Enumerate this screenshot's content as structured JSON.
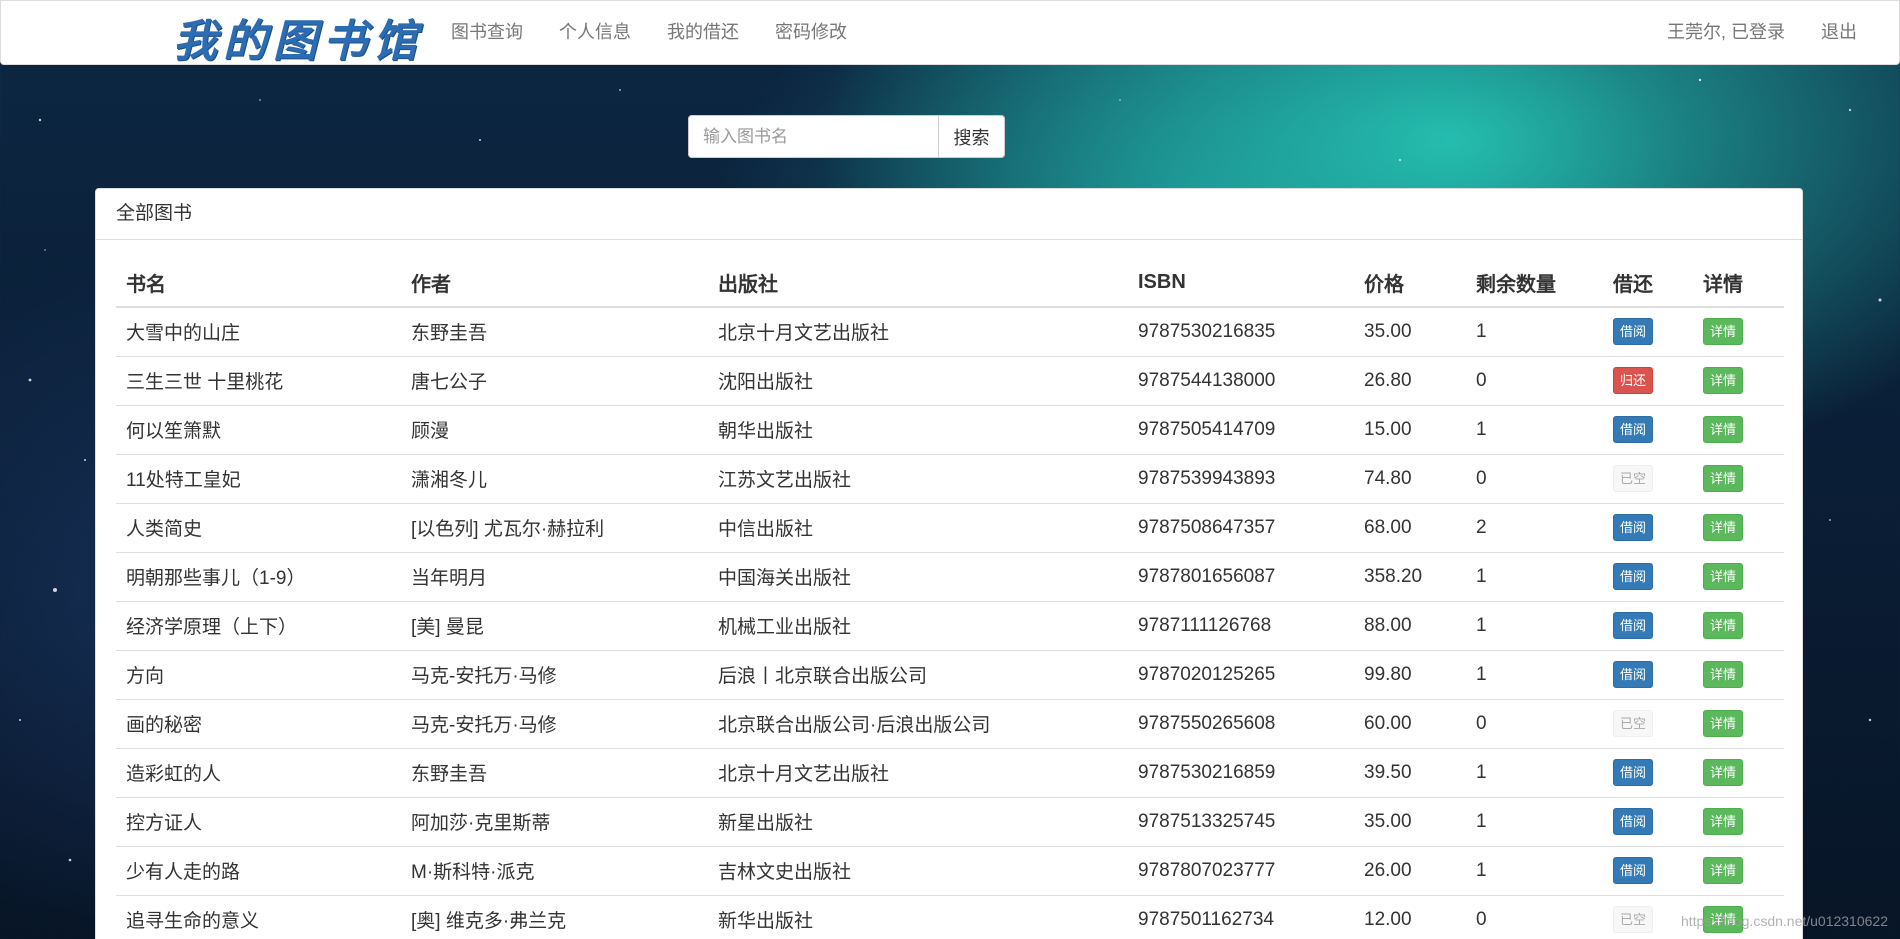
{
  "navbar": {
    "brand": "我的图书馆",
    "links": [
      "图书查询",
      "个人信息",
      "我的借还",
      "密码修改"
    ],
    "user_status": "王莞尔, 已登录",
    "logout": "退出"
  },
  "search": {
    "placeholder": "输入图书名",
    "button": "搜索"
  },
  "panel": {
    "title": "全部图书"
  },
  "table": {
    "headers": [
      "书名",
      "作者",
      "出版社",
      "ISBN",
      "价格",
      "剩余数量",
      "借还",
      "详情"
    ],
    "rows": [
      {
        "title": "大雪中的山庄",
        "author": "东野圭吾",
        "publisher": "北京十月文艺出版社",
        "isbn": "9787530216835",
        "price": "35.00",
        "stock": "1",
        "action": "借阅",
        "action_type": "borrow",
        "detail": "详情"
      },
      {
        "title": "三生三世 十里桃花",
        "author": "唐七公子",
        "publisher": "沈阳出版社",
        "isbn": "9787544138000",
        "price": "26.80",
        "stock": "0",
        "action": "归还",
        "action_type": "return",
        "detail": "详情"
      },
      {
        "title": "何以笙箫默",
        "author": "顾漫",
        "publisher": "朝华出版社",
        "isbn": "9787505414709",
        "price": "15.00",
        "stock": "1",
        "action": "借阅",
        "action_type": "borrow",
        "detail": "详情"
      },
      {
        "title": "11处特工皇妃",
        "author": "潇湘冬儿",
        "publisher": "江苏文艺出版社",
        "isbn": "9787539943893",
        "price": "74.80",
        "stock": "0",
        "action": "已空",
        "action_type": "empty",
        "detail": "详情"
      },
      {
        "title": "人类简史",
        "author": "[以色列] 尤瓦尔·赫拉利",
        "publisher": "中信出版社",
        "isbn": "9787508647357",
        "price": "68.00",
        "stock": "2",
        "action": "借阅",
        "action_type": "borrow",
        "detail": "详情"
      },
      {
        "title": "明朝那些事儿（1-9）",
        "author": "当年明月",
        "publisher": "中国海关出版社",
        "isbn": "9787801656087",
        "price": "358.20",
        "stock": "1",
        "action": "借阅",
        "action_type": "borrow",
        "detail": "详情"
      },
      {
        "title": "经济学原理（上下）",
        "author": "[美] 曼昆",
        "publisher": "机械工业出版社",
        "isbn": "9787111126768",
        "price": "88.00",
        "stock": "1",
        "action": "借阅",
        "action_type": "borrow",
        "detail": "详情"
      },
      {
        "title": "方向",
        "author": "马克-安托万·马修",
        "publisher": "后浪丨北京联合出版公司",
        "isbn": "9787020125265",
        "price": "99.80",
        "stock": "1",
        "action": "借阅",
        "action_type": "borrow",
        "detail": "详情"
      },
      {
        "title": "画的秘密",
        "author": "马克-安托万·马修",
        "publisher": "北京联合出版公司·后浪出版公司",
        "isbn": "9787550265608",
        "price": "60.00",
        "stock": "0",
        "action": "已空",
        "action_type": "empty",
        "detail": "详情"
      },
      {
        "title": "造彩虹的人",
        "author": "东野圭吾",
        "publisher": "北京十月文艺出版社",
        "isbn": "9787530216859",
        "price": "39.50",
        "stock": "1",
        "action": "借阅",
        "action_type": "borrow",
        "detail": "详情"
      },
      {
        "title": "控方证人",
        "author": "阿加莎·克里斯蒂",
        "publisher": "新星出版社",
        "isbn": "9787513325745",
        "price": "35.00",
        "stock": "1",
        "action": "借阅",
        "action_type": "borrow",
        "detail": "详情"
      },
      {
        "title": "少有人走的路",
        "author": "M·斯科特·派克",
        "publisher": "吉林文史出版社",
        "isbn": "9787807023777",
        "price": "26.00",
        "stock": "1",
        "action": "借阅",
        "action_type": "borrow",
        "detail": "详情"
      },
      {
        "title": "追寻生命的意义",
        "author": "[奥] 维克多·弗兰克",
        "publisher": "新华出版社",
        "isbn": "9787501162734",
        "price": "12.00",
        "stock": "0",
        "action": "已空",
        "action_type": "empty",
        "detail": "详情"
      }
    ]
  },
  "watermark": "https://blog.csdn.net/u012310622",
  "colors": {
    "borrow": "#337ab7",
    "return": "#d9534f",
    "detail": "#5cb85c",
    "empty": "#f7f7f7",
    "brand": "#2b6cb3"
  }
}
